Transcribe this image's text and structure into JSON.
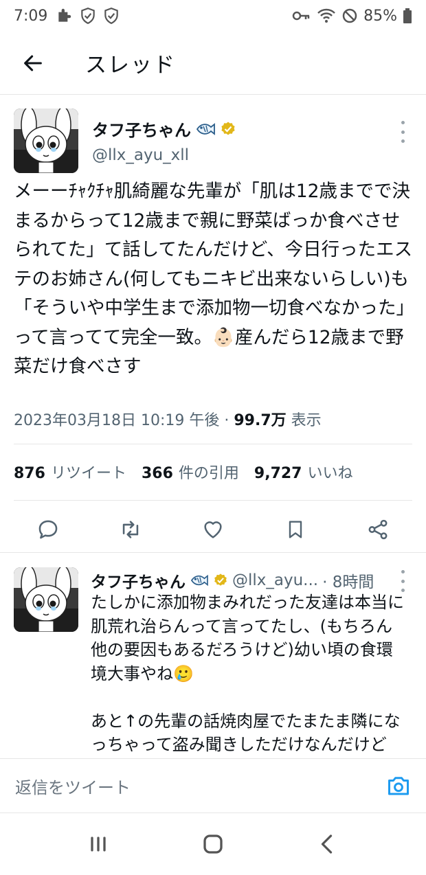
{
  "status": {
    "time": "7:09",
    "battery": "85%"
  },
  "header": {
    "title": "スレッド"
  },
  "tweet": {
    "display_name": "タフ子ちゃん",
    "handle": "@llx_ayu_xll",
    "text": "メーーﾁｬｸﾁｬ肌綺麗な先輩が「肌は12歳までで決まるからって12歳まで親に野菜ばっか食べさせられてた」て話してたんだけど、今日行ったエステのお姉さん(何してもニキビ出来ないらしい)も「そういや中学生まで添加物一切食べなかった」って言ってて完全一致。👶🏻産んだら12歳まで野菜だけ食べさす",
    "datetime": "2023年03月18日 10:19 午後",
    "separator": "·",
    "views_count": "99.7万",
    "views_label": "表示",
    "retweets_count": "876",
    "retweets_label": "リツイート",
    "quotes_count": "366",
    "quotes_label": "件の引用",
    "likes_count": "9,727",
    "likes_label": "いいね"
  },
  "reply": {
    "display_name": "タフ子ちゃん",
    "handle": "@llx_ayu...",
    "time": "· 8時間",
    "text": "たしかに添加物まみれだった友達は本当に肌荒れ治らんって言ってたし、(もちろん他の要因もあるだろうけど)幼い頃の食環境大事やね🥲\n\nあと↑の先輩の話焼肉屋でたまたま隣になっちゃって盗み聞きしただけなんだけど"
  },
  "reply_bar": {
    "placeholder": "返信をツイート"
  },
  "colors": {
    "accent": "#1d9bf0",
    "verified": "#e2b719",
    "text": "#0f1419",
    "secondary": "#536471"
  },
  "icons": {
    "back": "arrow-left-icon",
    "reply": "comment-icon",
    "retweet": "retweet-icon",
    "like": "heart-icon",
    "bookmark": "bookmark-icon",
    "share": "share-icon",
    "camera": "camera-icon"
  }
}
